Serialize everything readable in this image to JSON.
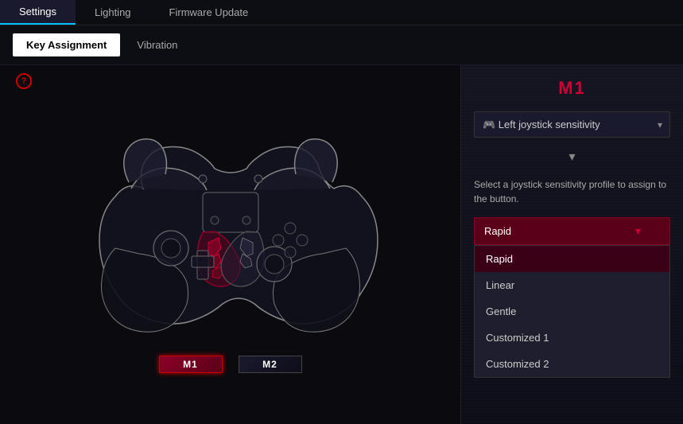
{
  "nav": {
    "tabs": [
      {
        "label": "Settings",
        "active": true
      },
      {
        "label": "Lighting",
        "active": false
      },
      {
        "label": "Firmware Update",
        "active": false
      }
    ]
  },
  "sub_tabs": {
    "tabs": [
      {
        "label": "Key Assignment",
        "active": true
      },
      {
        "label": "Vibration",
        "active": false
      }
    ]
  },
  "help_icon": "?",
  "macro_buttons": [
    {
      "label": "M1",
      "active": true
    },
    {
      "label": "M2",
      "active": false
    }
  ],
  "right_panel": {
    "title": "M1",
    "select_label": "Left joystick sensitivity",
    "chevron": "▾",
    "description": "Select a joystick sensitivity profile to assign to the button.",
    "dropdown": {
      "selected": "Rapid",
      "arrow": "▾",
      "options": [
        {
          "label": "Rapid",
          "selected": true
        },
        {
          "label": "Linear",
          "selected": false
        },
        {
          "label": "Gentle",
          "selected": false
        },
        {
          "label": "Customized 1",
          "selected": false
        },
        {
          "label": "Customized 2",
          "selected": false
        }
      ]
    }
  }
}
